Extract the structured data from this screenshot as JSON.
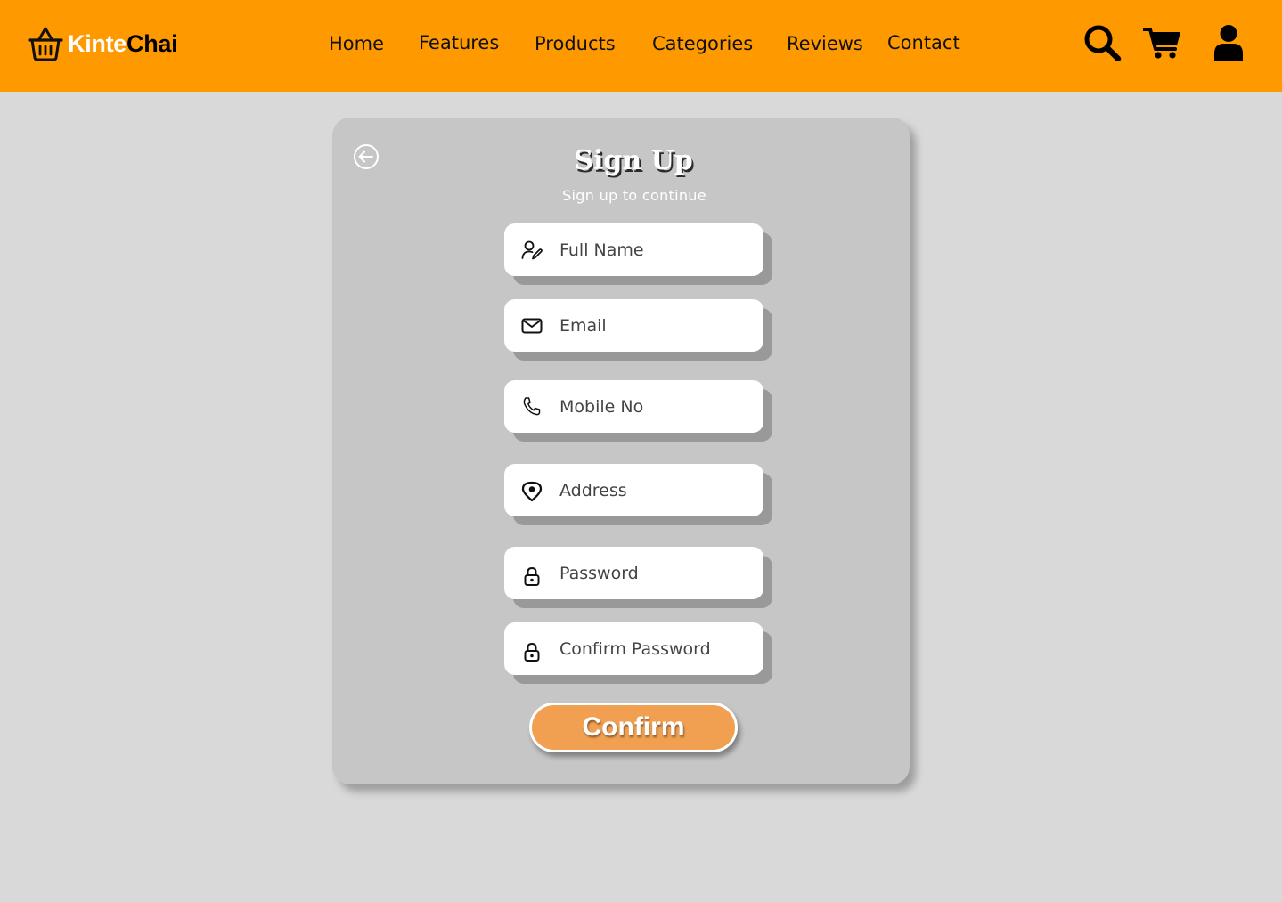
{
  "brand": {
    "name_part1": "Kinte",
    "name_part2": "Chai",
    "logo_icon": "shopping-basket-icon"
  },
  "nav": {
    "items": [
      {
        "label": "Home"
      },
      {
        "label": "Features"
      },
      {
        "label": "Products"
      },
      {
        "label": "Categories"
      },
      {
        "label": "Reviews"
      },
      {
        "label": "Contact"
      }
    ]
  },
  "header_icons": [
    "search-icon",
    "cart-icon",
    "user-icon"
  ],
  "signup": {
    "title": "Sign Up",
    "subtitle": "Sign up to continue",
    "back_icon": "back-arrow-icon",
    "fields": [
      {
        "placeholder": "Full Name",
        "icon": "user-edit-icon"
      },
      {
        "placeholder": "Email",
        "icon": "mail-icon"
      },
      {
        "placeholder": "Mobile No",
        "icon": "phone-icon"
      },
      {
        "placeholder": "Address",
        "icon": "location-pin-icon"
      },
      {
        "placeholder": "Password",
        "icon": "lock-icon"
      },
      {
        "placeholder": "Confirm Password",
        "icon": "lock-icon"
      }
    ],
    "confirm_label": "Confirm"
  },
  "colors": {
    "header_bg": "#ff9900",
    "page_bg": "#d9d9d9",
    "card_bg": "#c6c6c6",
    "field_shadow": "#999999",
    "confirm_bg": "#f0a050"
  }
}
